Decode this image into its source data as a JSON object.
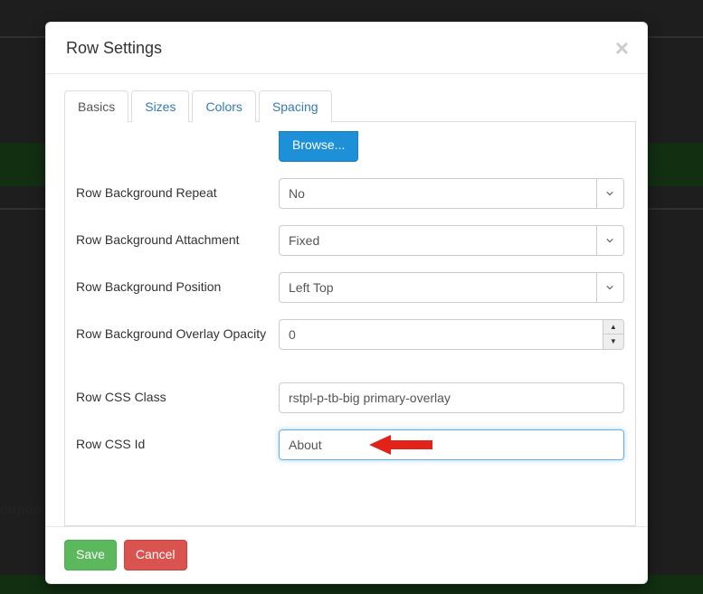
{
  "modal": {
    "title": "Row Settings"
  },
  "tabs": [
    {
      "id": "basics",
      "label": "Basics",
      "active": true
    },
    {
      "id": "sizes",
      "label": "Sizes",
      "active": false
    },
    {
      "id": "colors",
      "label": "Colors",
      "active": false
    },
    {
      "id": "spacing",
      "label": "Spacing",
      "active": false
    }
  ],
  "form": {
    "browse_label": "Browse...",
    "fields": [
      {
        "name": "row_background_repeat",
        "label": "Row Background Repeat",
        "type": "select",
        "value": "No"
      },
      {
        "name": "row_background_attachment",
        "label": "Row Background Attachment",
        "type": "select",
        "value": "Fixed"
      },
      {
        "name": "row_background_position",
        "label": "Row Background Position",
        "type": "select",
        "value": "Left Top"
      },
      {
        "name": "row_background_overlay_opacity",
        "label": "Row Background Overlay Opacity",
        "type": "spinner",
        "value": "0"
      },
      {
        "name": "row_css_class",
        "label": "Row CSS Class",
        "type": "text",
        "value": "rstpl-p-tb-big primary-overlay"
      },
      {
        "name": "row_css_id",
        "label": "Row CSS Id",
        "type": "text",
        "value": "About",
        "focused": true
      }
    ]
  },
  "footer": {
    "save": "Save",
    "cancel": "Cancel"
  },
  "background": {
    "cropped_text": "criptio"
  },
  "annotation": {
    "arrow_color": "#e2231a",
    "points_to": "input-css-id"
  },
  "colors": {
    "link": "#337ab7",
    "success": "#5cb85c",
    "danger": "#d9534f",
    "browse": "#1e90d8"
  }
}
